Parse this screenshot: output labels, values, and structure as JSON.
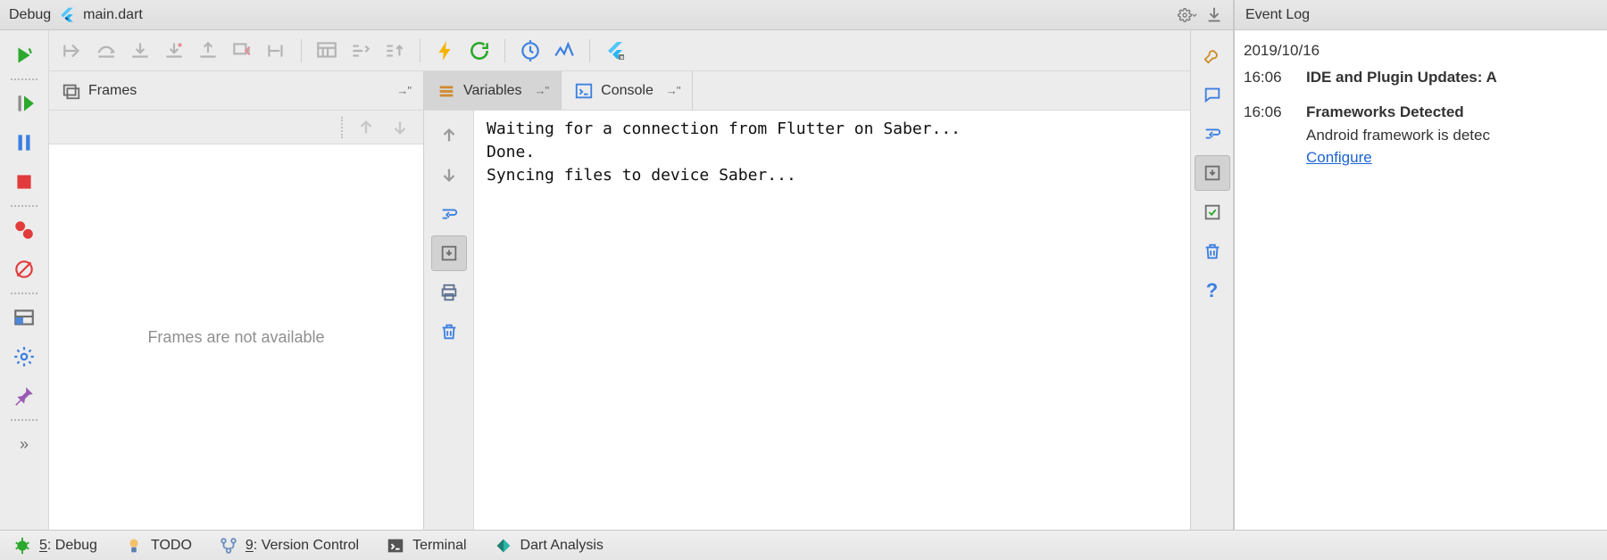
{
  "header": {
    "title": "Debug",
    "file": "main.dart"
  },
  "tabs": {
    "frames": "Frames",
    "variables": "Variables",
    "console": "Console"
  },
  "frames": {
    "empty_text": "Frames are not available"
  },
  "console": {
    "line1": "Waiting for a connection from Flutter on Saber...",
    "line2": "Done.",
    "line3": "Syncing files to device Saber..."
  },
  "eventlog": {
    "title": "Event Log",
    "date": "2019/10/16",
    "entries": [
      {
        "time": "16:06",
        "title": "IDE and Plugin Updates: A"
      },
      {
        "time": "16:06",
        "title": "Frameworks Detected",
        "body": "Android framework is detec",
        "link": "Configure"
      }
    ]
  },
  "statusbar": {
    "debug": "5: Debug",
    "todo": "TODO",
    "vc": "9: Version Control",
    "terminal": "Terminal",
    "dart": "Dart Analysis"
  }
}
